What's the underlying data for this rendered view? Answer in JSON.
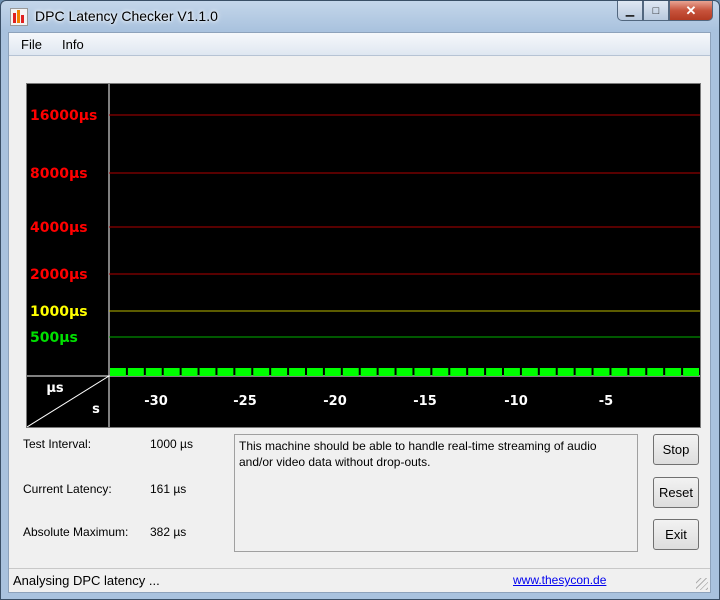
{
  "window": {
    "title": "DPC Latency Checker V1.1.0"
  },
  "menu": {
    "file": "File",
    "info": "Info"
  },
  "graph": {
    "y_levels": [
      {
        "label": "16000µs",
        "color": "#ff0000",
        "line": "#b00000"
      },
      {
        "label": "8000µs",
        "color": "#ff0000",
        "line": "#b00000"
      },
      {
        "label": "4000µs",
        "color": "#ff0000",
        "line": "#b00000"
      },
      {
        "label": "2000µs",
        "color": "#ff0000",
        "line": "#b00000"
      },
      {
        "label": "1000µs",
        "color": "#ffff00",
        "line": "#b8b800"
      },
      {
        "label": "500µs",
        "color": "#00e000",
        "line": "#00b000"
      }
    ],
    "x_ticks": [
      "-30",
      "-25",
      "-20",
      "-15",
      "-10",
      "-5"
    ],
    "corner_y_unit": "µs",
    "corner_x_unit": "s",
    "bar_color": "#00ff00",
    "bars_us": [
      175,
      160,
      150,
      170,
      165,
      165,
      190,
      185,
      180,
      310,
      175,
      215,
      185,
      185,
      200,
      170,
      175,
      230,
      160,
      290,
      190,
      305,
      235,
      190,
      180,
      150,
      160,
      180,
      160,
      140,
      190,
      200,
      205
    ]
  },
  "stats": {
    "interval_label": "Test Interval:",
    "interval_value": "1000 µs",
    "current_label": "Current Latency:",
    "current_value": "161 µs",
    "max_label": "Absolute Maximum:",
    "max_value": "382 µs"
  },
  "message": "This machine should be able to handle real-time streaming of audio and/or video data without drop-outs.",
  "buttons": {
    "stop": "Stop",
    "reset": "Reset",
    "exit": "Exit"
  },
  "status": {
    "text": "Analysing DPC latency ...",
    "link": "www.thesycon.de"
  }
}
